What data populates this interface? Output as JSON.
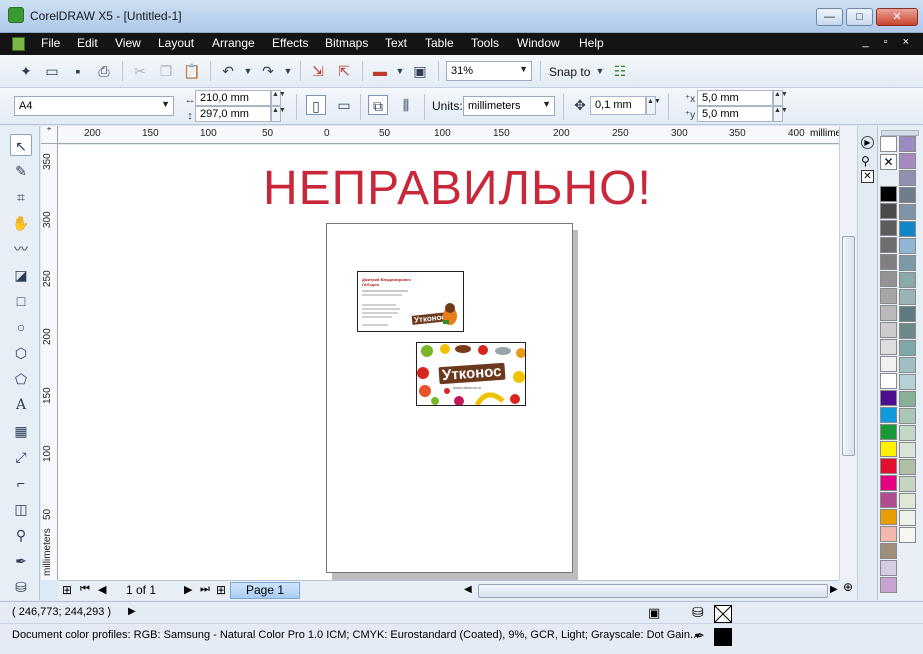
{
  "window": {
    "title": "CorelDRAW X5 - [Untitled-1]",
    "min_glyph": "—",
    "max_glyph": "□",
    "close_glyph": "✕"
  },
  "menu": {
    "items": [
      "File",
      "Edit",
      "View",
      "Layout",
      "Arrange",
      "Effects",
      "Bitmaps",
      "Text",
      "Table",
      "Tools",
      "Window",
      "Help"
    ],
    "mdi_controls": "_ ▫ ×"
  },
  "toolbar": {
    "zoom": "31%",
    "snap_label": "Snap to"
  },
  "property_bar": {
    "page_size": "A4",
    "width": "210,0 mm",
    "height": "297,0 mm",
    "units_label": "Units:",
    "units": "millimeters",
    "nudge": "0,1 mm",
    "dup_x": "5,0 mm",
    "dup_y": "5,0 mm"
  },
  "ruler": {
    "h_ticks": [
      "200",
      "150",
      "100",
      "50",
      "0",
      "50",
      "100",
      "150",
      "200",
      "250",
      "300",
      "350",
      "400"
    ],
    "h_unit": "millimeters",
    "v_ticks": [
      "350",
      "300",
      "250",
      "200",
      "150",
      "100",
      "50"
    ],
    "v_unit": "millimeters"
  },
  "canvas": {
    "heading": "НЕПРАВИЛЬНО!",
    "card1": {
      "name_line1": "Дмитрий Владимирович",
      "name_line2": "Лебедев",
      "brand": "Утконос"
    },
    "card2": {
      "brand": "Утконос",
      "url": "www.utkonos.ru"
    }
  },
  "page_nav": {
    "counter": "1 of 1",
    "tab": "Page 1"
  },
  "status": {
    "coords": "( 246,773; 244,293 )",
    "profiles": "Document color profiles: RGB: Samsung - Natural Color Pro 1.0 ICM; CMYK: Eurostandard (Coated), 9%, GCR, Light; Grayscale: Dot Gain..."
  },
  "palette": {
    "left_column": [
      "#000000",
      "#4a4a4a",
      "#5c5c5c",
      "#6e6e6e",
      "#808080",
      "#939393",
      "#a6a6a6",
      "#b9b9b9",
      "#cccccc",
      "#dedede",
      "#f1f1f1",
      "#ffffff",
      "#4b0f8f",
      "#1199dd",
      "#1a9a3a",
      "#fff200",
      "#e0102e",
      "#e4007f",
      "#b04d8f",
      "#e69f00",
      "#f2b8b0",
      "#9d8f7a",
      "#d7cde2",
      "#c7a3d0"
    ],
    "right_column": [
      "#9c8ac0",
      "#a689bd",
      "#8f8fb0",
      "#6f7e8a",
      "#7d93a8",
      "#0e86c8",
      "#8fb6d3",
      "#7b9aa5",
      "#8aa8a8",
      "#9cb3b5",
      "#607a82",
      "#6d8888",
      "#7fa6a9",
      "#9fbfc2",
      "#b4d2d6",
      "#88b097",
      "#a9c7b4",
      "#c2d8c7",
      "#d7e5d6",
      "#aebfa6",
      "#c6d3c0",
      "#dfe8d5",
      "#eef2e8",
      "#f6f7f0"
    ]
  }
}
